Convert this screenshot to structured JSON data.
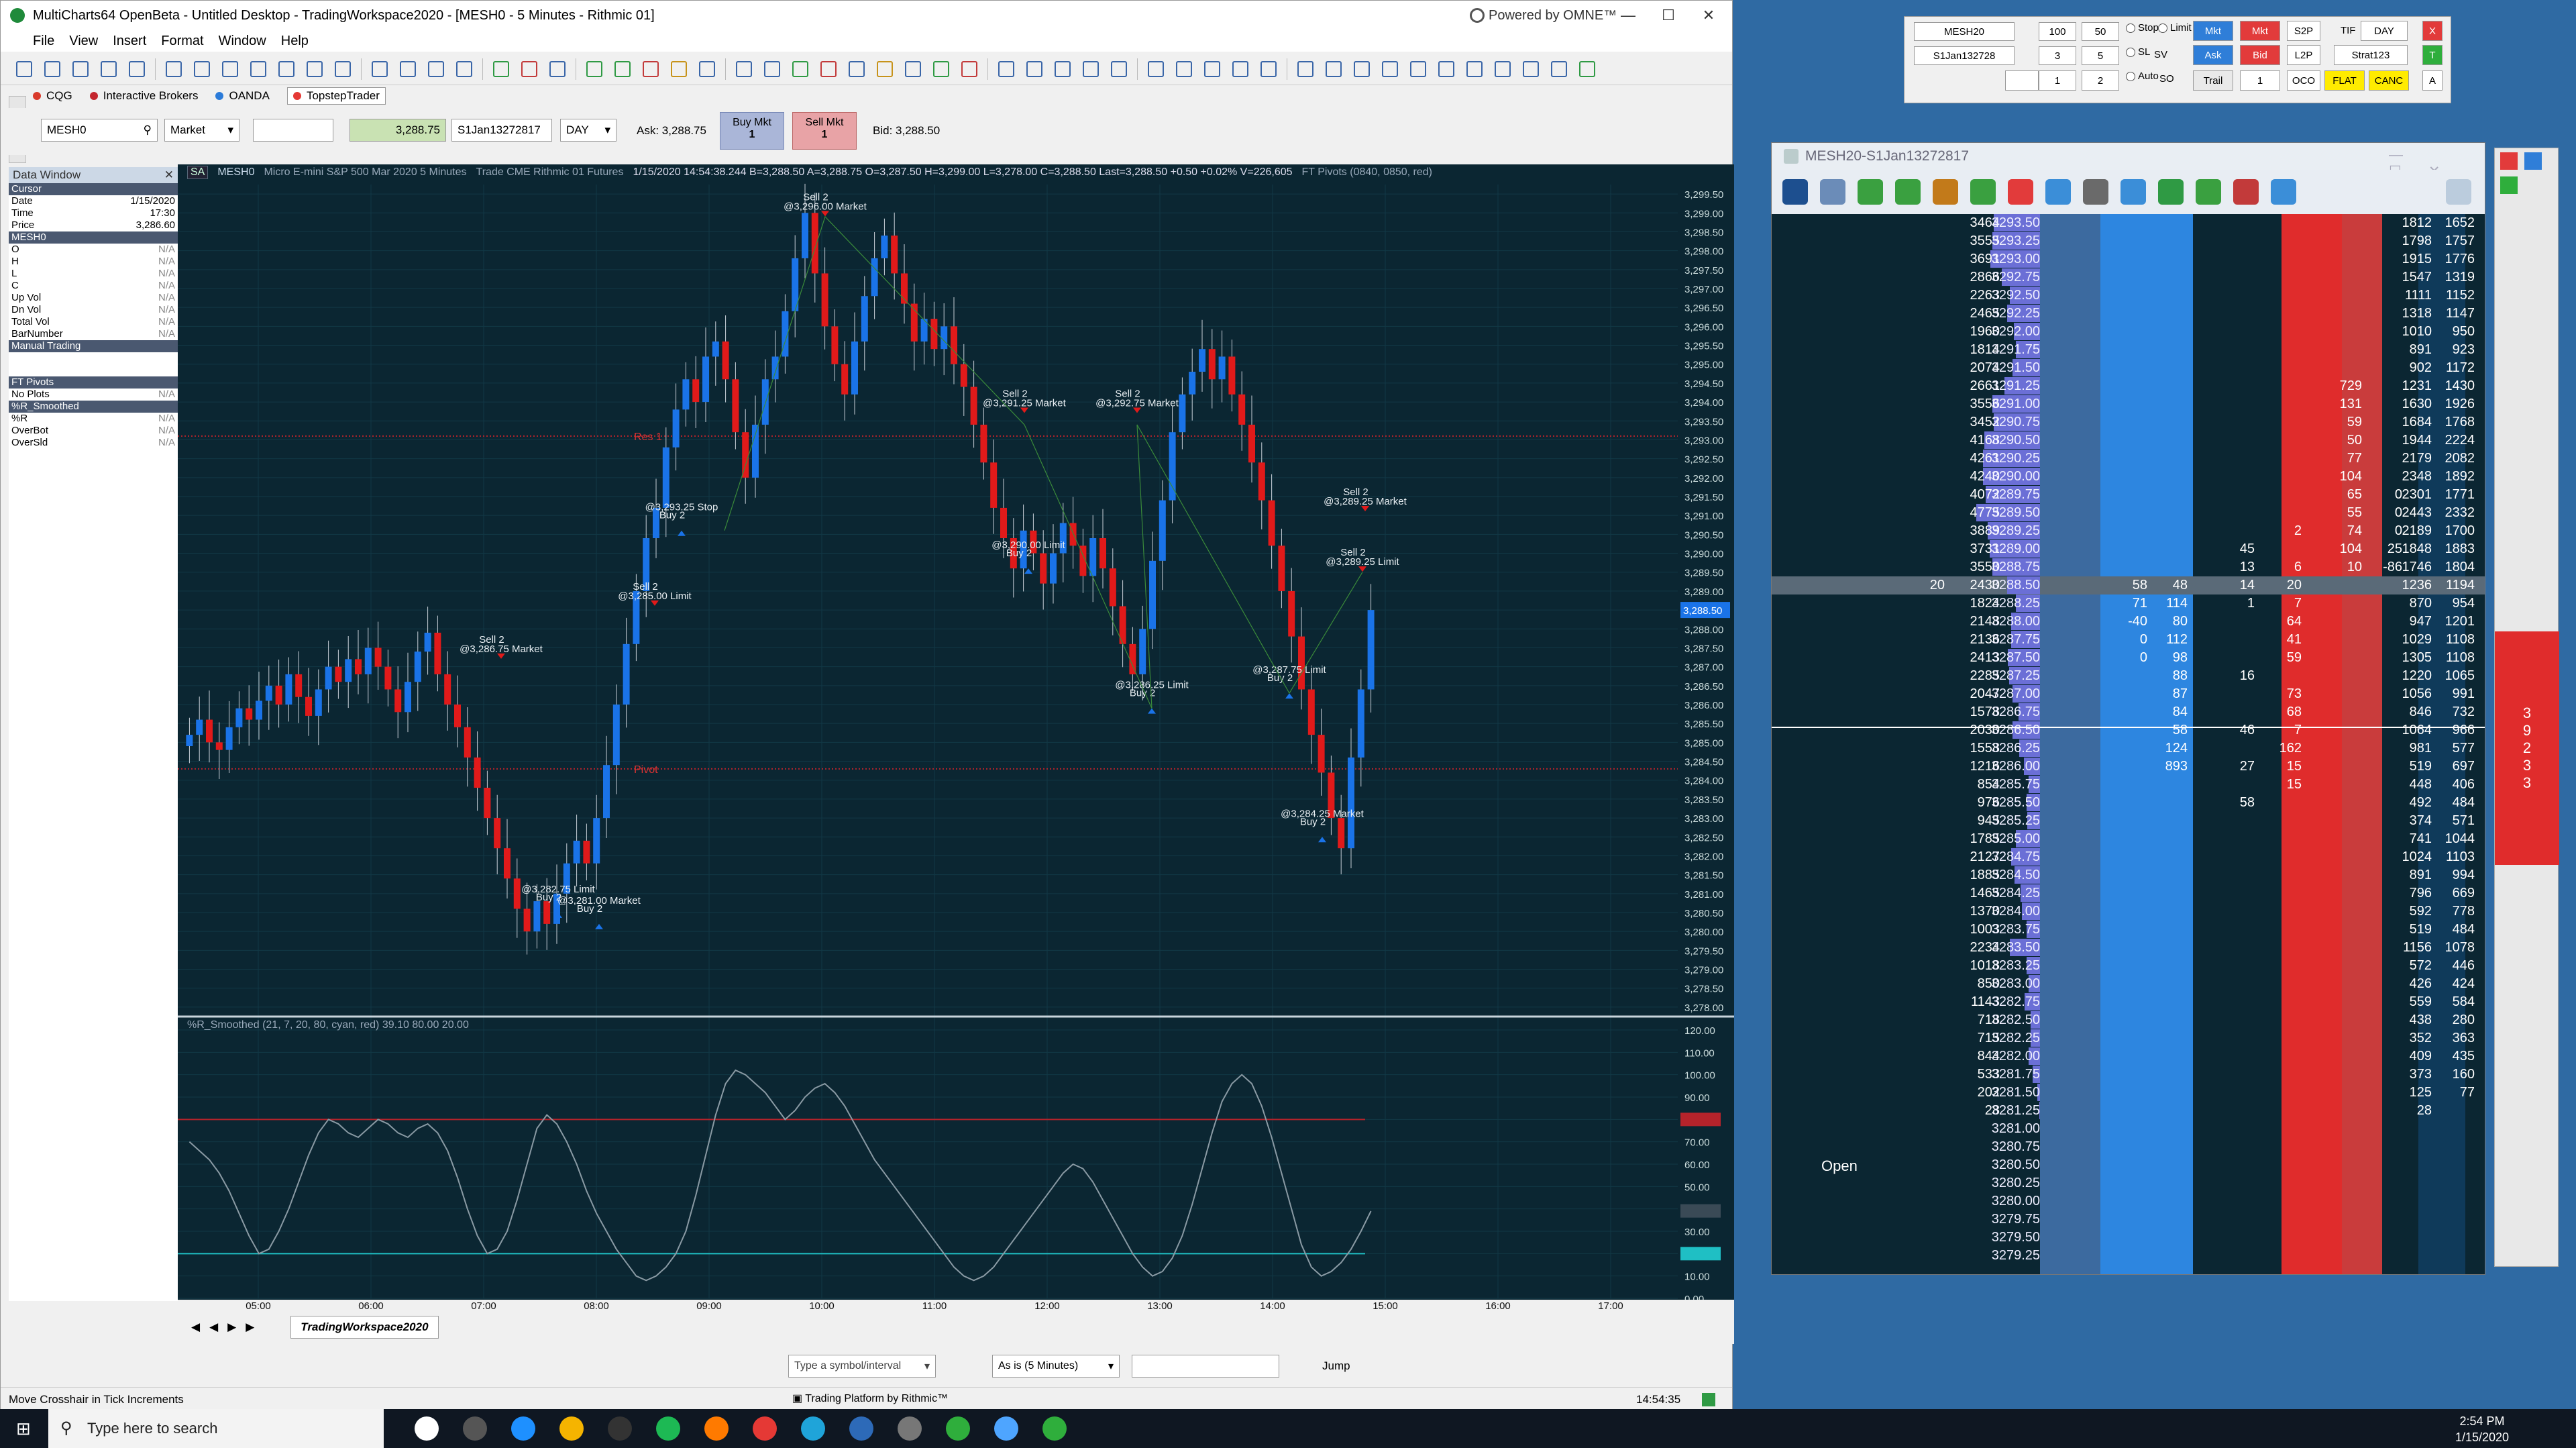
{
  "app": {
    "title": "MultiCharts64 OpenBeta - Untitled Desktop - TradingWorkspace2020 - [MESH0 - 5 Minutes - Rithmic 01]",
    "powered": "Powered by OMNE™",
    "menu": [
      "File",
      "View",
      "Insert",
      "Format",
      "Window",
      "Help"
    ]
  },
  "brokers": [
    "CQG",
    "Interactive Brokers",
    "OANDA",
    "TopstepTrader"
  ],
  "broker_colors": [
    "#d93a2b",
    "#c4262e",
    "#2b7bd9",
    "#e53935"
  ],
  "trade_bar": {
    "symbol": "MESH0",
    "order_type": "Market",
    "price": "3,288.75",
    "account": "S1Jan13272817",
    "tif": "DAY",
    "ask": "Ask: 3,288.75",
    "bid": "Bid: 3,288.50",
    "buy_label": "Buy Mkt",
    "buy_qty": "1",
    "sell_label": "Sell Mkt",
    "sell_qty": "1"
  },
  "data_window": {
    "title": "Data Window",
    "rows": [
      {
        "k": "Cursor",
        "v": "",
        "sec": true
      },
      {
        "k": "Date",
        "v": "1/15/2020"
      },
      {
        "k": "Time",
        "v": "17:30"
      },
      {
        "k": "Price",
        "v": "3,286.60"
      },
      {
        "k": "MESH0",
        "v": "",
        "sec": true
      },
      {
        "k": "O",
        "v": "N/A"
      },
      {
        "k": "H",
        "v": "N/A"
      },
      {
        "k": "L",
        "v": "N/A"
      },
      {
        "k": "C",
        "v": "N/A"
      },
      {
        "k": "Up Vol",
        "v": "N/A"
      },
      {
        "k": "Dn Vol",
        "v": "N/A"
      },
      {
        "k": "Total Vol",
        "v": "N/A"
      },
      {
        "k": "BarNumber",
        "v": "N/A"
      },
      {
        "k": "Manual Trading",
        "v": "",
        "sec": true
      },
      {
        "k": "",
        "v": ""
      },
      {
        "k": "",
        "v": ""
      },
      {
        "k": "FT Pivots",
        "v": "",
        "sec": true
      },
      {
        "k": "No Plots",
        "v": "N/A"
      },
      {
        "k": "%R_Smoothed",
        "v": "",
        "sec": true
      },
      {
        "k": "%R",
        "v": "N/A"
      },
      {
        "k": "OverBot",
        "v": "N/A"
      },
      {
        "k": "OverSld",
        "v": "N/A"
      }
    ]
  },
  "chart_info": {
    "symbol": "MESH0",
    "desc": "Micro E-mini S&P 500 Mar 2020  5 Minutes",
    "source": "Trade  CME  Rithmic 01  Futures",
    "ohlc": "1/15/2020  14:54:38.244  B=3,288.50  A=3,288.75  O=3,287.50  H=3,299.00  L=3,278.00  C=3,288.50  Last=3,288.50  +0.50  +0.02%  V=226,605",
    "pivots": "FT Pivots   (0840, 0850, red)",
    "osc": "%R_Smoothed   (21, 7, 20, 80, cyan, red)  39.10  80.00  20.00"
  },
  "chart_data": {
    "type": "candlestick",
    "x_ticks": [
      "05:00",
      "06:00",
      "07:00",
      "08:00",
      "09:00",
      "10:00",
      "11:00",
      "12:00",
      "13:00",
      "14:00",
      "15:00",
      "16:00",
      "17:00"
    ],
    "y_ticks": [
      3278.0,
      3278.5,
      3279.0,
      3279.5,
      3280.0,
      3280.5,
      3281.0,
      3281.5,
      3282.0,
      3282.5,
      3283.0,
      3283.5,
      3284.0,
      3284.5,
      3285.0,
      3285.5,
      3286.0,
      3286.5,
      3287.0,
      3287.5,
      3288.0,
      3288.5,
      3289.0,
      3289.5,
      3290.0,
      3290.5,
      3291.0,
      3291.5,
      3292.0,
      3292.5,
      3293.0,
      3293.5,
      3294.0,
      3294.5,
      3295.0,
      3295.5,
      3296.0,
      3296.5,
      3297.0,
      3297.5,
      3298.0,
      3298.5,
      3299.0,
      3299.5
    ],
    "ylim": [
      3277.75,
      3299.75
    ],
    "last_price": "3,288.50",
    "pivot_labels": {
      "r1": "Res 1",
      "pp": "Pivot"
    },
    "pivots": {
      "r1": 3293.1,
      "pp": 3284.3
    },
    "closes": [
      3285.2,
      3285.6,
      3285.0,
      3284.8,
      3285.4,
      3285.9,
      3285.6,
      3286.1,
      3286.5,
      3286.0,
      3286.8,
      3286.2,
      3285.7,
      3286.4,
      3287.0,
      3286.6,
      3287.2,
      3286.8,
      3287.5,
      3287.0,
      3286.4,
      3285.8,
      3286.6,
      3287.4,
      3287.9,
      3286.8,
      3286.0,
      3285.4,
      3284.6,
      3283.8,
      3283.0,
      3282.2,
      3281.4,
      3280.6,
      3280.0,
      3280.8,
      3280.2,
      3281.0,
      3281.8,
      3282.4,
      3281.8,
      3283.0,
      3284.4,
      3286.0,
      3287.6,
      3289.0,
      3290.4,
      3291.2,
      3292.8,
      3293.8,
      3294.6,
      3294.0,
      3295.2,
      3295.6,
      3294.6,
      3293.2,
      3292.0,
      3293.4,
      3294.6,
      3295.2,
      3296.4,
      3297.8,
      3299.0,
      3297.4,
      3296.0,
      3295.0,
      3294.2,
      3295.6,
      3296.8,
      3297.8,
      3298.4,
      3297.4,
      3296.6,
      3295.6,
      3296.2,
      3295.4,
      3296.0,
      3295.0,
      3294.4,
      3293.4,
      3292.4,
      3291.2,
      3290.4,
      3289.6,
      3290.6,
      3290.0,
      3289.2,
      3290.0,
      3290.8,
      3290.2,
      3289.4,
      3290.4,
      3289.6,
      3288.6,
      3287.6,
      3286.8,
      3288.0,
      3289.8,
      3291.4,
      3293.2,
      3294.2,
      3294.8,
      3295.4,
      3294.6,
      3295.2,
      3294.2,
      3293.4,
      3292.4,
      3291.4,
      3290.2,
      3289.0,
      3287.8,
      3286.4,
      3285.2,
      3284.2,
      3283.0,
      3282.2,
      3284.6,
      3286.4,
      3288.5
    ],
    "orders": [
      {
        "label": "Sell 2",
        "price_label": "@3,296.00 Market",
        "y": 3299.3
      },
      {
        "label": "Sell 2",
        "price_label": "@3,291.25 Market",
        "y": 3294.1
      },
      {
        "label": "Sell 2",
        "price_label": "@3,292.75 Market",
        "y": 3294.1
      },
      {
        "label": "Sell 2",
        "price_label": "@3,289.25 Market",
        "y": 3291.5
      },
      {
        "label": "Sell 2",
        "price_label": "@3,286.75 Market",
        "y": 3287.6
      },
      {
        "label": "Sell 2",
        "price_label": "@3,285.00 Limit",
        "y": 3289.0
      },
      {
        "label": "Sell 2",
        "price_label": "@3,289.25 Limit",
        "y": 3289.9
      },
      {
        "label": "Buy 2",
        "price_label": "@3,293.25 Stop",
        "y": 3290.6
      },
      {
        "label": "Buy 2",
        "price_label": "@3,290.00 Limit",
        "y": 3289.6
      },
      {
        "label": "Buy 2",
        "price_label": "@3,286.25 Limit",
        "y": 3285.9
      },
      {
        "label": "Buy 2",
        "price_label": "@3,287.75 Limit",
        "y": 3286.3
      },
      {
        "label": "Buy 2",
        "price_label": "@3,284.25 Market",
        "y": 3282.5
      },
      {
        "label": "Buy 2",
        "price_label": "@3,282.75 Limit",
        "y": 3280.5
      },
      {
        "label": "Buy 2",
        "price_label": "@3,281.00 Market",
        "y": 3280.2
      }
    ],
    "oscillator": {
      "name": "%R_Smoothed",
      "ylim": [
        0,
        120
      ],
      "y_ticks": [
        0,
        10,
        20,
        30,
        40,
        50,
        60,
        70,
        80,
        90,
        100,
        110,
        120
      ],
      "overbought": 80,
      "oversold": 20,
      "last": 39.1,
      "values": [
        70,
        66,
        62,
        56,
        48,
        38,
        28,
        20,
        22,
        30,
        40,
        52,
        64,
        74,
        80,
        78,
        74,
        72,
        76,
        80,
        78,
        74,
        72,
        76,
        78,
        74,
        66,
        54,
        40,
        28,
        20,
        22,
        30,
        44,
        60,
        76,
        82,
        78,
        70,
        60,
        48,
        38,
        30,
        22,
        16,
        10,
        8,
        10,
        14,
        20,
        30,
        46,
        64,
        82,
        96,
        102,
        100,
        96,
        92,
        86,
        80,
        84,
        90,
        94,
        96,
        92,
        86,
        78,
        70,
        62,
        56,
        50,
        44,
        38,
        32,
        26,
        20,
        14,
        10,
        8,
        10,
        14,
        20,
        26,
        32,
        38,
        44,
        50,
        56,
        60,
        58,
        52,
        44,
        36,
        28,
        20,
        14,
        10,
        12,
        18,
        28,
        42,
        58,
        74,
        88,
        96,
        100,
        96,
        86,
        72,
        56,
        40,
        24,
        14,
        10,
        12,
        16,
        22,
        30,
        39
      ]
    }
  },
  "bottom": {
    "workspace_tab": "TradingWorkspace2020",
    "symbol_input_placeholder": "Type a symbol/interval",
    "interval_select": "As is (5 Minutes)",
    "jump": "Jump",
    "status_left": "Move Crosshair in Tick Increments",
    "status_right": "14:54:35"
  },
  "dom": {
    "title": "MESH20-S1Jan13272817",
    "ctl": {
      "symbol": "MESH20",
      "account": "S1Jan132728",
      "qtys": [
        "100",
        "50",
        "3",
        "5",
        "1",
        "2"
      ],
      "stop": "Stop",
      "limit": "Limit",
      "sl": "SL",
      "sv": "SV",
      "auto": "Auto",
      "so": "SO",
      "mkt_buy": "Mkt",
      "mkt_sell": "Mkt",
      "ask": "Ask",
      "bid": "Bid",
      "s2p": "S2P",
      "l2p": "L2P",
      "oco": "OCO",
      "trail": "Trail",
      "trail_qty": "1",
      "tif_label": "TIF",
      "tif": "DAY",
      "strategy": "Strat123",
      "flat": "FLAT",
      "canc": "CANC",
      "x": "X",
      "t": "T",
      "a": "A"
    },
    "open_label": "Open",
    "ladder": [
      {
        "p": "3293.50",
        "bv": "3464",
        "rs": "1812",
        "rt": "1652"
      },
      {
        "p": "3293.25",
        "bv": "3555",
        "rs": "1798",
        "rt": "1757"
      },
      {
        "p": "3293.00",
        "bv": "3691",
        "rs": "1915",
        "rt": "1776"
      },
      {
        "p": "3292.75",
        "bv": "2866",
        "rs": "1547",
        "rt": "1319"
      },
      {
        "p": "3292.50",
        "bv": "2263",
        "rs": "1111",
        "rt": "1152"
      },
      {
        "p": "3292.25",
        "bv": "2465",
        "rs": "1318",
        "rt": "1147"
      },
      {
        "p": "3292.00",
        "bv": "1960",
        "rs": "1010",
        "rt": "950"
      },
      {
        "p": "3291.75",
        "bv": "1814",
        "rs": "891",
        "rt": "923"
      },
      {
        "p": "3291.50",
        "bv": "2074",
        "rs": "902",
        "rt": "1172"
      },
      {
        "p": "3291.25",
        "bv": "2661",
        "rs": "1231",
        "rt": "1430",
        "ask": "729"
      },
      {
        "p": "3291.00",
        "bv": "3556",
        "rs": "1630",
        "rt": "1926",
        "ask": "131"
      },
      {
        "p": "3290.75",
        "bv": "3452",
        "rs": "1684",
        "rt": "1768",
        "ask": "59"
      },
      {
        "p": "3290.50",
        "bv": "4168",
        "rs": "1944",
        "rt": "2224",
        "ask": "50"
      },
      {
        "p": "3290.25",
        "bv": "4261",
        "rs": "2179",
        "rt": "2082",
        "ask": "77"
      },
      {
        "p": "3290.00",
        "bv": "4240",
        "rs": "2348",
        "rt": "1892",
        "ask": "104"
      },
      {
        "p": "3289.75",
        "bv": "4072",
        "rs": "2301",
        "rt": "1771",
        "ask": "65",
        "c2": "0"
      },
      {
        "p": "3289.50",
        "bv": "4775",
        "rs": "2443",
        "rt": "2332",
        "ask": "55",
        "c2": "0"
      },
      {
        "p": "3289.25",
        "bv": "3889",
        "rs": "2189",
        "rt": "1700",
        "ask": "74",
        "c2": "0",
        "c0": "2"
      },
      {
        "p": "3289.00",
        "bv": "3731",
        "rs": "1848",
        "rt": "1883",
        "ask": "104",
        "c2": "25",
        "cA": "45"
      },
      {
        "p": "3288.75",
        "bv": "3550",
        "rs": "1746",
        "rt": "1804",
        "ask": "10",
        "c2": "-86",
        "cA": "13",
        "c0": "6"
      },
      {
        "p": "3288.50",
        "bv": "2430",
        "rs": "1236",
        "rt": "1194",
        "b1": "58",
        "b2": "48",
        "cA": "14",
        "c0": "20",
        "lf": "20",
        "cur": true
      },
      {
        "p": "3288.25",
        "bv": "1824",
        "rs": "870",
        "rt": "954",
        "b1": "71",
        "b2": "114",
        "cA": "1",
        "c0": "7"
      },
      {
        "p": "3288.00",
        "bv": "2148",
        "rs": "947",
        "rt": "1201",
        "b1": "-40",
        "b2": "80",
        "c0": "64"
      },
      {
        "p": "3287.75",
        "bv": "2136",
        "rs": "1029",
        "rt": "1108",
        "b1": "0",
        "b2": "112",
        "c0": "41"
      },
      {
        "p": "3287.50",
        "bv": "2413",
        "rs": "1305",
        "rt": "1108",
        "b1": "0",
        "b2": "98",
        "c0": "59"
      },
      {
        "p": "3287.25",
        "bv": "2285",
        "rs": "1220",
        "rt": "1065",
        "b2": "88",
        "cA": "16"
      },
      {
        "p": "3287.00",
        "bv": "2047",
        "rs": "1056",
        "rt": "991",
        "b2": "87",
        "c0": "73"
      },
      {
        "p": "3286.75",
        "bv": "1578",
        "rs": "846",
        "rt": "732",
        "b2": "84",
        "c0": "68"
      },
      {
        "p": "3286.50",
        "bv": "2030",
        "rs": "1064",
        "rt": "966",
        "b2": "58",
        "cA": "46",
        "c0": "7"
      },
      {
        "p": "3286.25",
        "bv": "1558",
        "rs": "981",
        "rt": "577",
        "b2": "124",
        "c0": "162"
      },
      {
        "p": "3286.00",
        "bv": "1216",
        "rs": "519",
        "rt": "697",
        "b2": "893",
        "cA": "27",
        "c0": "15"
      },
      {
        "p": "3285.75",
        "bv": "854",
        "rs": "448",
        "rt": "406",
        "c0": "15"
      },
      {
        "p": "3285.50",
        "bv": "976",
        "rs": "492",
        "rt": "484",
        "cA": "58"
      },
      {
        "p": "3285.25",
        "bv": "945",
        "rs": "374",
        "rt": "571"
      },
      {
        "p": "3285.00",
        "bv": "1785",
        "rs": "741",
        "rt": "1044"
      },
      {
        "p": "3284.75",
        "bv": "2127",
        "rs": "1024",
        "rt": "1103"
      },
      {
        "p": "3284.50",
        "bv": "1885",
        "rs": "891",
        "rt": "994"
      },
      {
        "p": "3284.25",
        "bv": "1465",
        "rs": "796",
        "rt": "669"
      },
      {
        "p": "3284.00",
        "bv": "1370",
        "rs": "592",
        "rt": "778"
      },
      {
        "p": "3283.75",
        "bv": "1003",
        "rs": "519",
        "rt": "484"
      },
      {
        "p": "3283.50",
        "bv": "2234",
        "rs": "1156",
        "rt": "1078"
      },
      {
        "p": "3283.25",
        "bv": "1018",
        "rs": "572",
        "rt": "446"
      },
      {
        "p": "3283.00",
        "bv": "850",
        "rs": "426",
        "rt": "424"
      },
      {
        "p": "3282.75",
        "bv": "1143",
        "rs": "559",
        "rt": "584"
      },
      {
        "p": "3282.50",
        "bv": "718",
        "rs": "438",
        "rt": "280"
      },
      {
        "p": "3282.25",
        "bv": "715",
        "rs": "352",
        "rt": "363"
      },
      {
        "p": "3282.00",
        "bv": "844",
        "rs": "409",
        "rt": "435"
      },
      {
        "p": "3281.75",
        "bv": "533",
        "rs": "373",
        "rt": "160"
      },
      {
        "p": "3281.50",
        "bv": "202",
        "rs": "125",
        "rt": "77"
      },
      {
        "p": "3281.25",
        "bv": "28",
        "rs": "28",
        "rt": ""
      },
      {
        "p": "3281.00",
        "bv": "",
        "rs": "",
        "rt": ""
      },
      {
        "p": "3280.75",
        "bv": "",
        "rs": "",
        "rt": ""
      },
      {
        "p": "3280.50",
        "bv": "",
        "rs": "",
        "rt": ""
      },
      {
        "p": "3280.25",
        "bv": "",
        "rs": "",
        "rt": ""
      },
      {
        "p": "3280.00",
        "bv": "",
        "rs": "",
        "rt": ""
      },
      {
        "p": "3279.75",
        "bv": "",
        "rs": "",
        "rt": ""
      },
      {
        "p": "3279.50",
        "bv": "",
        "rs": "",
        "rt": ""
      },
      {
        "p": "3279.25",
        "bv": "",
        "rs": "",
        "rt": ""
      }
    ],
    "side_digits": [
      "3",
      "9",
      "2",
      "3",
      "3"
    ]
  },
  "taskbar": {
    "search_placeholder": "Type here to search",
    "time": "2:54 PM",
    "date": "1/15/2020"
  },
  "colors": {
    "up": "#1a73e8",
    "down": "#e11a1a",
    "chart_bg": "#0b2632",
    "ask_col": "#d63333",
    "bid_col": "#2d86e0",
    "vol_bar": "#6b6fd6"
  }
}
